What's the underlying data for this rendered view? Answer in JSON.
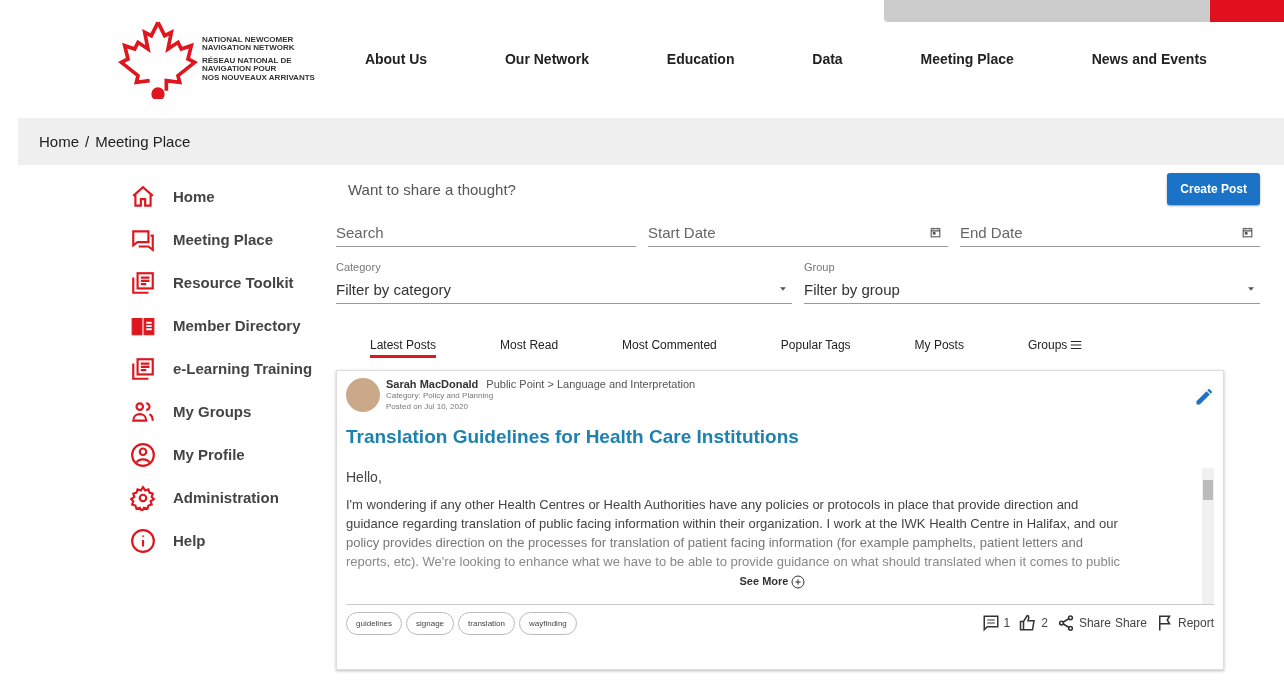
{
  "logo": {
    "lines_en": [
      "NATIONAL NEWCOMER",
      "NAVIGATION NETWORK"
    ],
    "lines_fr": [
      "RÉSEAU NATIONAL DE",
      "NAVIGATION POUR",
      "NOS NOUVEAUX ARRIVANTS"
    ]
  },
  "nav": [
    "About Us",
    "Our Network",
    "Education",
    "Data",
    "Meeting Place",
    "News and Events"
  ],
  "breadcrumb": [
    "Home",
    "Meeting Place"
  ],
  "breadcrumb_separator": "/",
  "sidebar": {
    "items": [
      {
        "label": "Home"
      },
      {
        "label": "Meeting Place"
      },
      {
        "label": "Resource Toolkit"
      },
      {
        "label": "Member Directory"
      },
      {
        "label": "e-Learning Training"
      },
      {
        "label": "My Groups"
      },
      {
        "label": "My Profile"
      },
      {
        "label": "Administration"
      },
      {
        "label": "Help"
      }
    ]
  },
  "composer": {
    "placeholder": "Want to share a thought?",
    "button": "Create Post"
  },
  "filters": {
    "search": {
      "placeholder": "Search"
    },
    "start_date": {
      "placeholder": "Start Date"
    },
    "end_date": {
      "placeholder": "End Date"
    },
    "category": {
      "label": "Category",
      "value": "Filter by category"
    },
    "group": {
      "label": "Group",
      "value": "Filter by group"
    }
  },
  "tabs": [
    {
      "label": "Latest Posts",
      "selected": true
    },
    {
      "label": "Most Read",
      "selected": false
    },
    {
      "label": "Most Commented",
      "selected": false
    },
    {
      "label": "Popular Tags",
      "selected": false
    },
    {
      "label": "My Posts",
      "selected": false
    },
    {
      "label": "Groups",
      "selected": false
    }
  ],
  "post": {
    "author": "Sarah MacDonald",
    "location": "Public Point > Language and Interpretation",
    "category": "Category: Policy and Planning",
    "posted": "Posted on Jul 10, 2020",
    "title": "Translation Guidelines for Health Care Institutions",
    "greeting": "Hello,",
    "body_lines": [
      "I'm wondering if any other Health Centres or Health Authorities have any policies or protocols in place that provide direction and",
      "guidance regarding translation of public facing information within their organization.  I work at the IWK Health Centre in Halifax, and our",
      "policy provides direction on the processes for translation of patient facing information (for example pamphelts, patient letters and",
      "reports, etc).  We're looking to enhance what we have to be able to provide guidance on what should translated when it comes to public"
    ],
    "see_more": "See More",
    "tags": [
      "guidelines",
      "signage",
      "translation",
      "wayfinding"
    ],
    "comments": "1",
    "likes": "2",
    "share_label": "Share",
    "share": "Share",
    "report": "Report"
  }
}
